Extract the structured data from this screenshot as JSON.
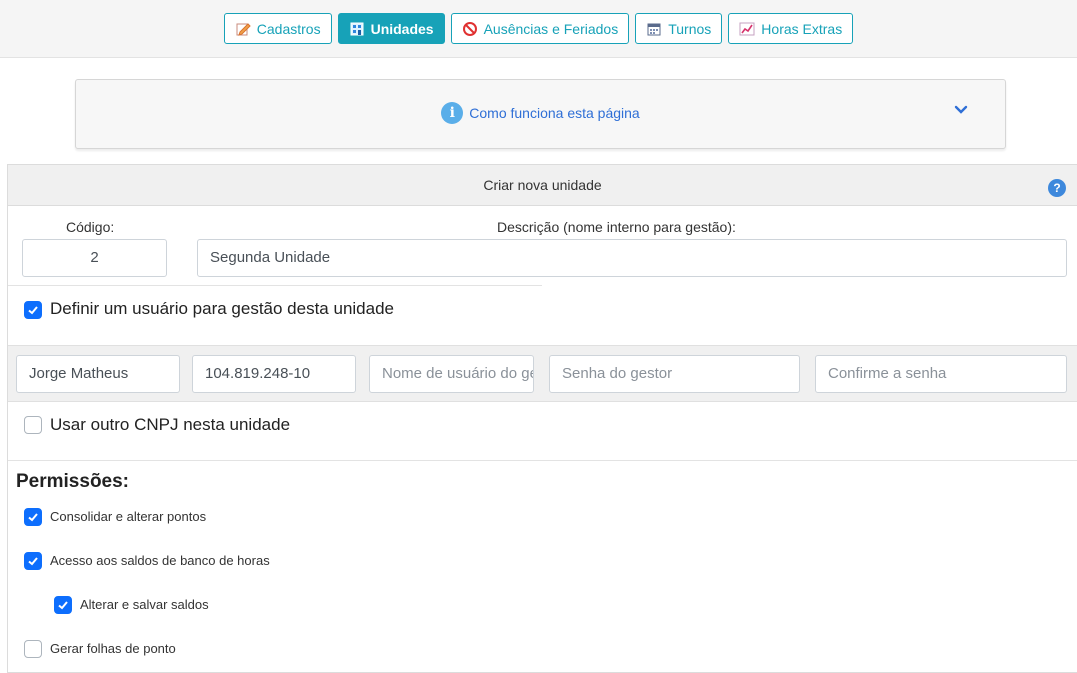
{
  "nav": {
    "buttons": [
      {
        "label": "Cadastros",
        "icon": "edit-icon",
        "active": false
      },
      {
        "label": "Unidades",
        "icon": "building-icon",
        "active": true
      },
      {
        "label": "Ausências e Feriados",
        "icon": "prohibited-icon",
        "active": false
      },
      {
        "label": "Turnos",
        "icon": "calendar-icon",
        "active": false
      },
      {
        "label": "Horas Extras",
        "icon": "chart-line-icon",
        "active": false
      }
    ],
    "accent": "#17a2b8"
  },
  "help_panel": {
    "label": "Como funciona esta página",
    "icon": "info-icon",
    "toggle_icon": "chevron-down-icon"
  },
  "form": {
    "title": "Criar nova unidade",
    "help_icon": "question-icon",
    "codigo_label": "Código:",
    "codigo_value": "2",
    "descricao_label": "Descrição (nome interno para gestão):",
    "descricao_value": "Segunda Unidade",
    "manager_checkbox": {
      "label": "Definir um usuário para gestão desta unidade",
      "checked": true
    },
    "manager_fields": {
      "name_value": "Jorge Matheus",
      "cpf_value": "104.819.248-10",
      "username_placeholder": "Nome de usuário do gestor",
      "password_placeholder": "Senha do gestor",
      "confirm_placeholder": "Confirme a senha"
    },
    "cnpj_checkbox": {
      "label": "Usar outro CNPJ nesta unidade",
      "checked": false
    },
    "permissions_title": "Permissões:",
    "permissions": [
      {
        "label": "Consolidar e alterar pontos",
        "checked": true
      },
      {
        "label": "Acesso aos saldos de banco de horas",
        "checked": true
      },
      {
        "label": "Alterar e salvar saldos",
        "checked": true
      },
      {
        "label": "Gerar folhas de ponto",
        "checked": false
      }
    ],
    "checkbox_color": "#0d6efd"
  }
}
